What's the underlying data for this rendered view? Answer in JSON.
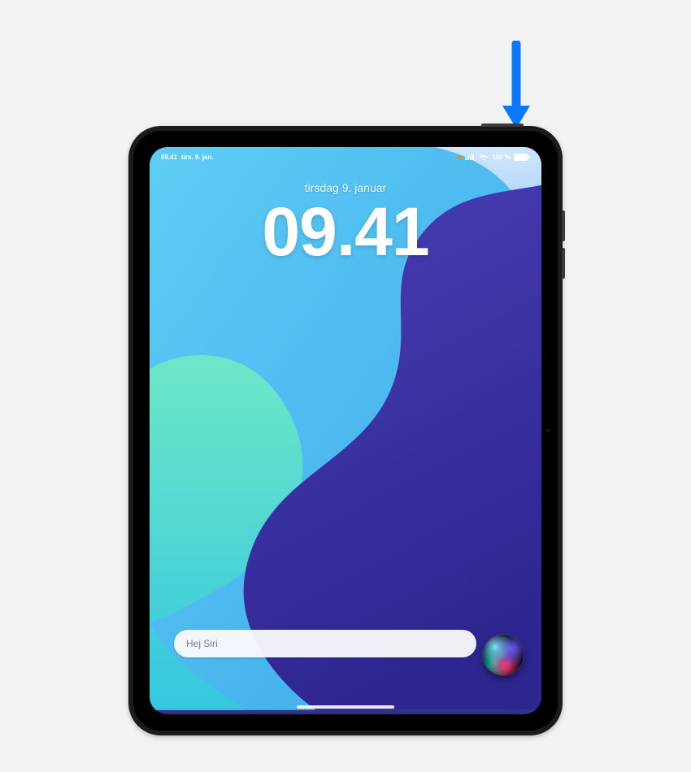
{
  "status": {
    "time": "09.41",
    "day_short": "tirs. 9. jan.",
    "battery": "100 %",
    "mic_indicator": "orange-dot",
    "cellular_icon": "cellular-bars-icon",
    "wifi_icon": "wifi-icon",
    "battery_icon": "battery-full-icon"
  },
  "lock_screen": {
    "date": "tirsdag 9. januar",
    "clock": "09.41",
    "siri_placeholder": "Hej Siri",
    "siri_icon": "siri-orb-icon",
    "home_indicator_icon": "home-indicator"
  },
  "hardware": {
    "top_button_icon": "top-button",
    "volume_up_icon": "volume-up-button",
    "volume_down_icon": "volume-down-button",
    "front_camera_icon": "front-camera"
  },
  "annotation": {
    "arrow_icon": "arrow-down-blue-icon"
  }
}
